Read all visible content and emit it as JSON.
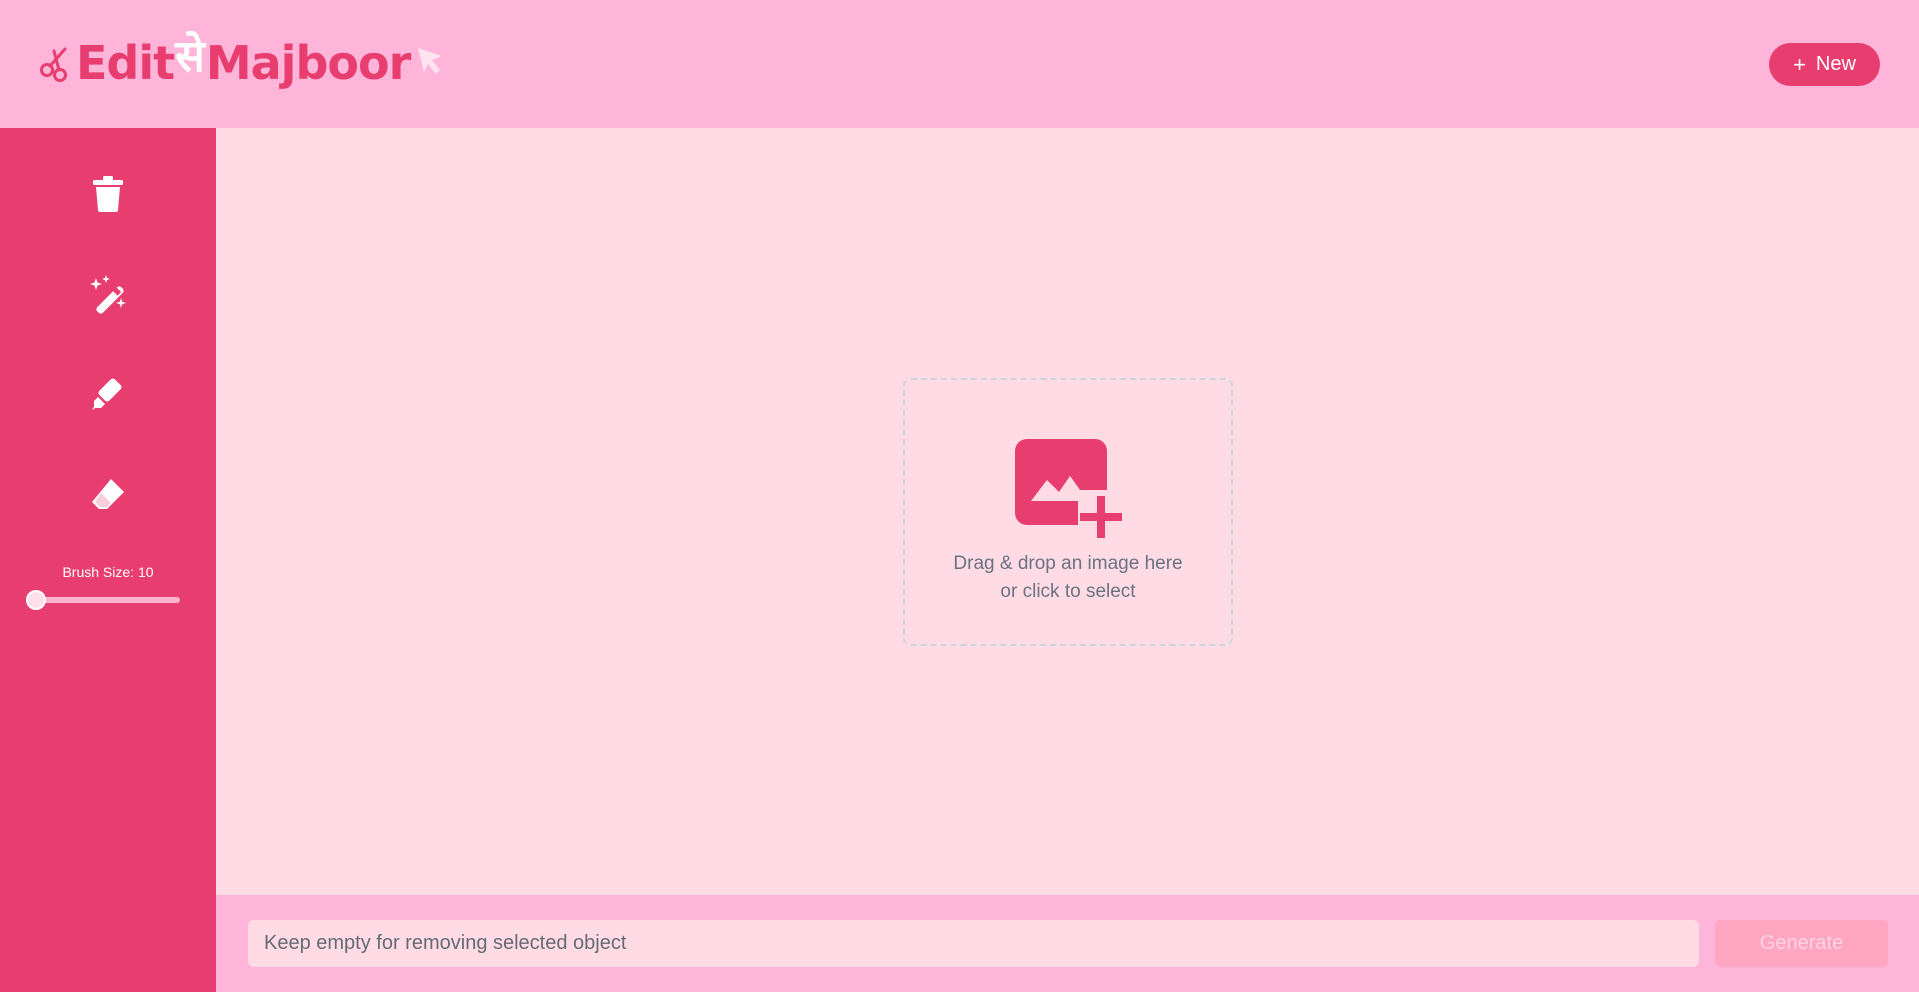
{
  "app": {
    "logo_part1": "Edit",
    "logo_hindi": "से",
    "logo_part2": "Majboor",
    "brand_color": "#e83d6f",
    "header_color": "#ffb5da"
  },
  "header": {
    "new_button_icon": "plus-icon",
    "new_button_label": "New"
  },
  "sidebar": {
    "tools": [
      {
        "name": "trash-icon",
        "label": "Clear"
      },
      {
        "name": "magic-wand-icon",
        "label": "Magic select"
      },
      {
        "name": "marker-icon",
        "label": "Brush"
      },
      {
        "name": "eraser-icon",
        "label": "Eraser"
      }
    ],
    "brush_size_label": "Brush Size: 10",
    "brush_size_value": 10,
    "brush_size_fraction": 0.0
  },
  "dropzone": {
    "icon": "add-image-icon",
    "line1": "Drag & drop an image here",
    "line2": "or click to select"
  },
  "prompt": {
    "placeholder": "Keep empty for removing selected object",
    "value": "",
    "generate_label": "Generate"
  }
}
